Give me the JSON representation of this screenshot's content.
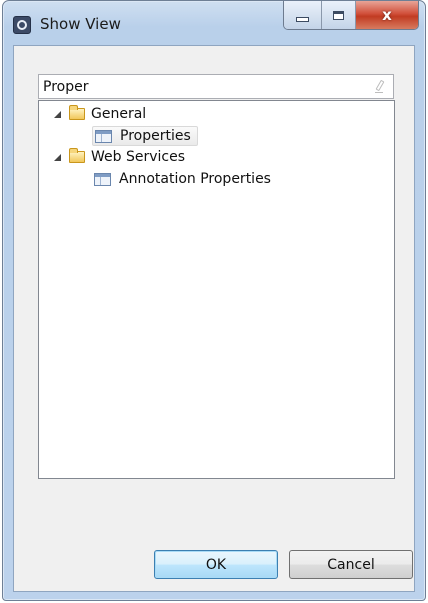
{
  "window": {
    "title": "Show View",
    "close_glyph": "x"
  },
  "filter": {
    "value": "Proper"
  },
  "tree": {
    "general": {
      "label": "General",
      "icon": "folder-icon",
      "expanded": true
    },
    "properties": {
      "label": "Properties",
      "icon": "view-icon",
      "selected": true
    },
    "web_services": {
      "label": "Web Services",
      "icon": "folder-icon",
      "expanded": true
    },
    "annotation_properties": {
      "label": "Annotation Properties",
      "icon": "view-icon"
    }
  },
  "buttons": {
    "ok_label": "OK",
    "cancel_label": "Cancel"
  },
  "colors": {
    "frame": "#bcd2ec",
    "close_button": "#c13b22",
    "default_button_border": "#3c7fb1"
  }
}
